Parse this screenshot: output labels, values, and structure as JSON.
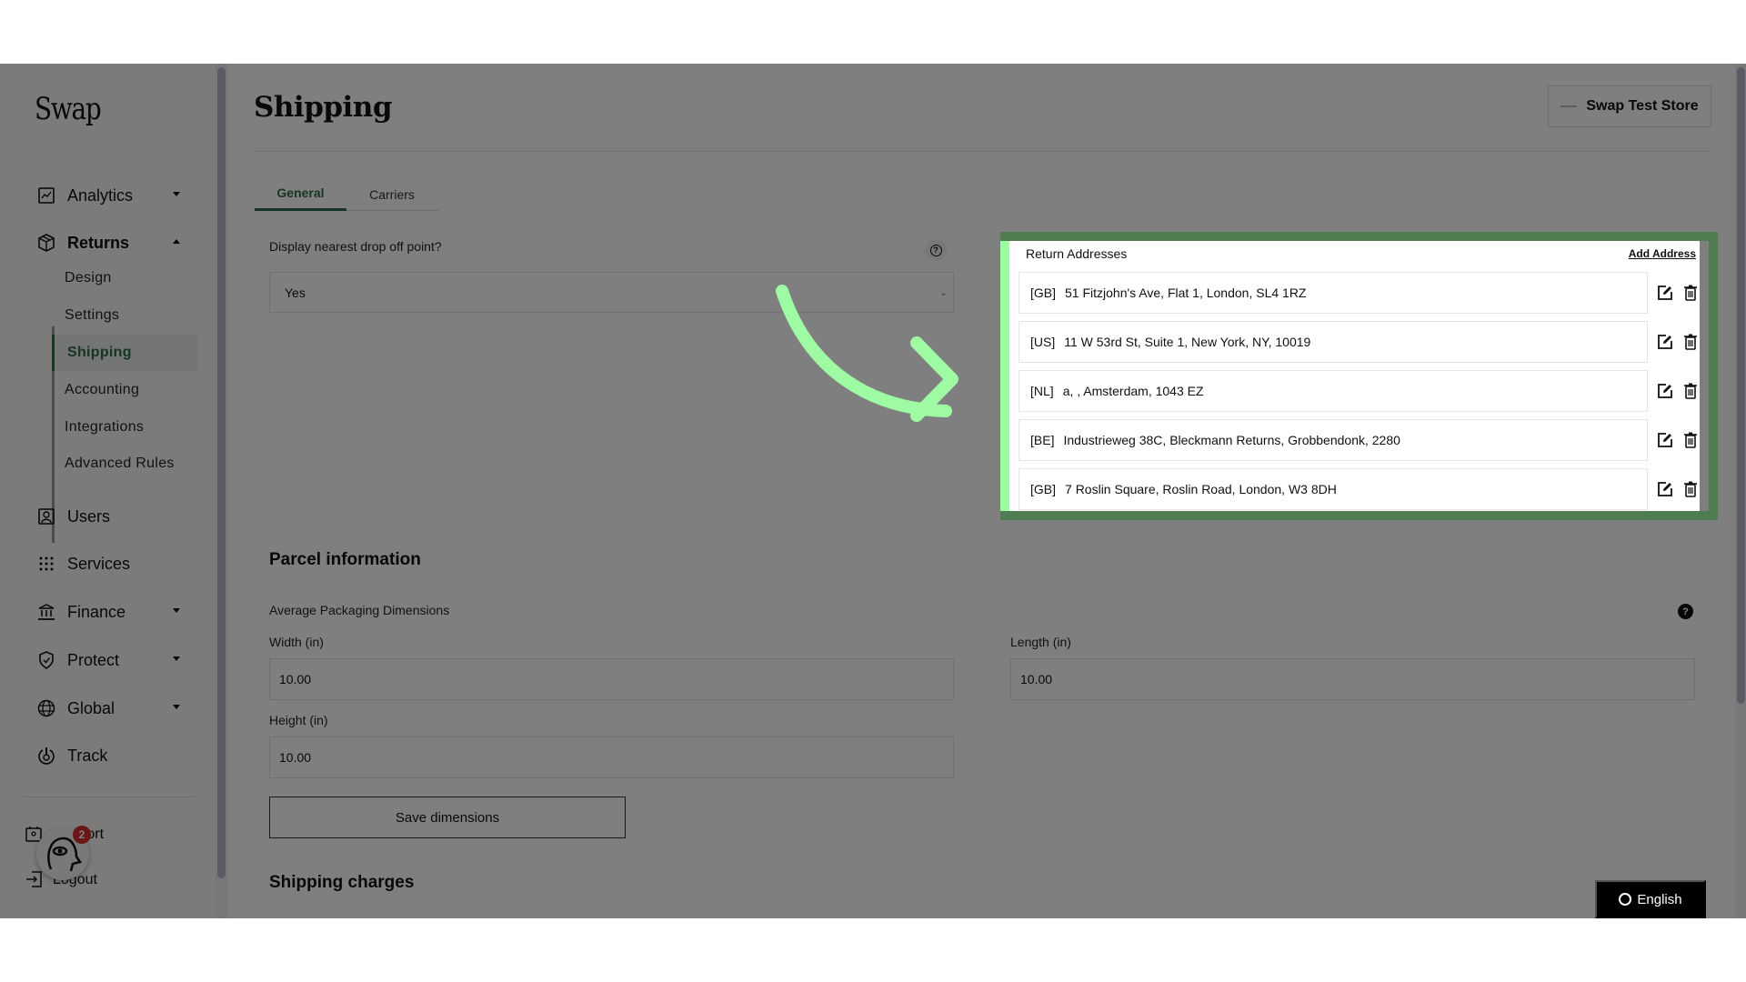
{
  "app": {
    "logo": "Swap"
  },
  "sidebar": {
    "items": [
      {
        "label": "Analytics",
        "icon": "chart-icon",
        "expandable": true,
        "expanded": false
      },
      {
        "label": "Returns",
        "icon": "box-icon",
        "expandable": true,
        "expanded": true
      },
      {
        "label": "Users",
        "icon": "user-icon",
        "expandable": false
      },
      {
        "label": "Services",
        "icon": "grid-icon",
        "expandable": false
      },
      {
        "label": "Finance",
        "icon": "bank-icon",
        "expandable": true,
        "expanded": false
      },
      {
        "label": "Protect",
        "icon": "shield-icon",
        "expandable": true,
        "expanded": false
      },
      {
        "label": "Global",
        "icon": "globe-icon",
        "expandable": true,
        "expanded": false
      },
      {
        "label": "Track",
        "icon": "track-icon",
        "expandable": false
      }
    ],
    "returns_subitems": [
      {
        "label": "Design",
        "active": false
      },
      {
        "label": "Settings",
        "active": false
      },
      {
        "label": "Shipping",
        "active": true
      },
      {
        "label": "Accounting",
        "active": false
      },
      {
        "label": "Integrations",
        "active": false
      },
      {
        "label": "Advanced Rules",
        "active": false
      }
    ],
    "bottom": {
      "support_label": "Support",
      "logout_label": "Logout",
      "notification_count": "2"
    }
  },
  "header": {
    "title": "Shipping",
    "store_name": "Swap Test Store"
  },
  "tabs": [
    {
      "label": "General",
      "active": true
    },
    {
      "label": "Carriers",
      "active": false
    }
  ],
  "drop_off": {
    "label": "Display nearest drop off point?",
    "value": "Yes"
  },
  "return_addresses": {
    "title": "Return Addresses",
    "add_label": "Add Address",
    "items": [
      {
        "country": "[GB]",
        "address": "51 Fitzjohn's Ave, Flat 1, London, SL4 1RZ"
      },
      {
        "country": "[US]",
        "address": "11 W 53rd St, Suite 1, New York, NY, 10019"
      },
      {
        "country": "[NL]",
        "address": "a, , Amsterdam, 1043 EZ"
      },
      {
        "country": "[BE]",
        "address": "Industrieweg 38C, Bleckmann Returns, Grobbendonk, 2280"
      },
      {
        "country": "[GB]",
        "address": "7 Roslin Square, Roslin Road, London, W3 8DH"
      }
    ]
  },
  "parcel": {
    "section_title": "Parcel information",
    "subtitle": "Average Packaging Dimensions",
    "width_label": "Width (in)",
    "width_value": "10.00",
    "length_label": "Length (in)",
    "length_value": "10.00",
    "height_label": "Height (in)",
    "height_value": "10.00",
    "save_label": "Save dimensions"
  },
  "shipping_charges": {
    "section_title": "Shipping charges"
  },
  "language": {
    "label": "English"
  },
  "annotation": {
    "highlight_color": "#9ffba3",
    "overlay_color": "#000000"
  }
}
